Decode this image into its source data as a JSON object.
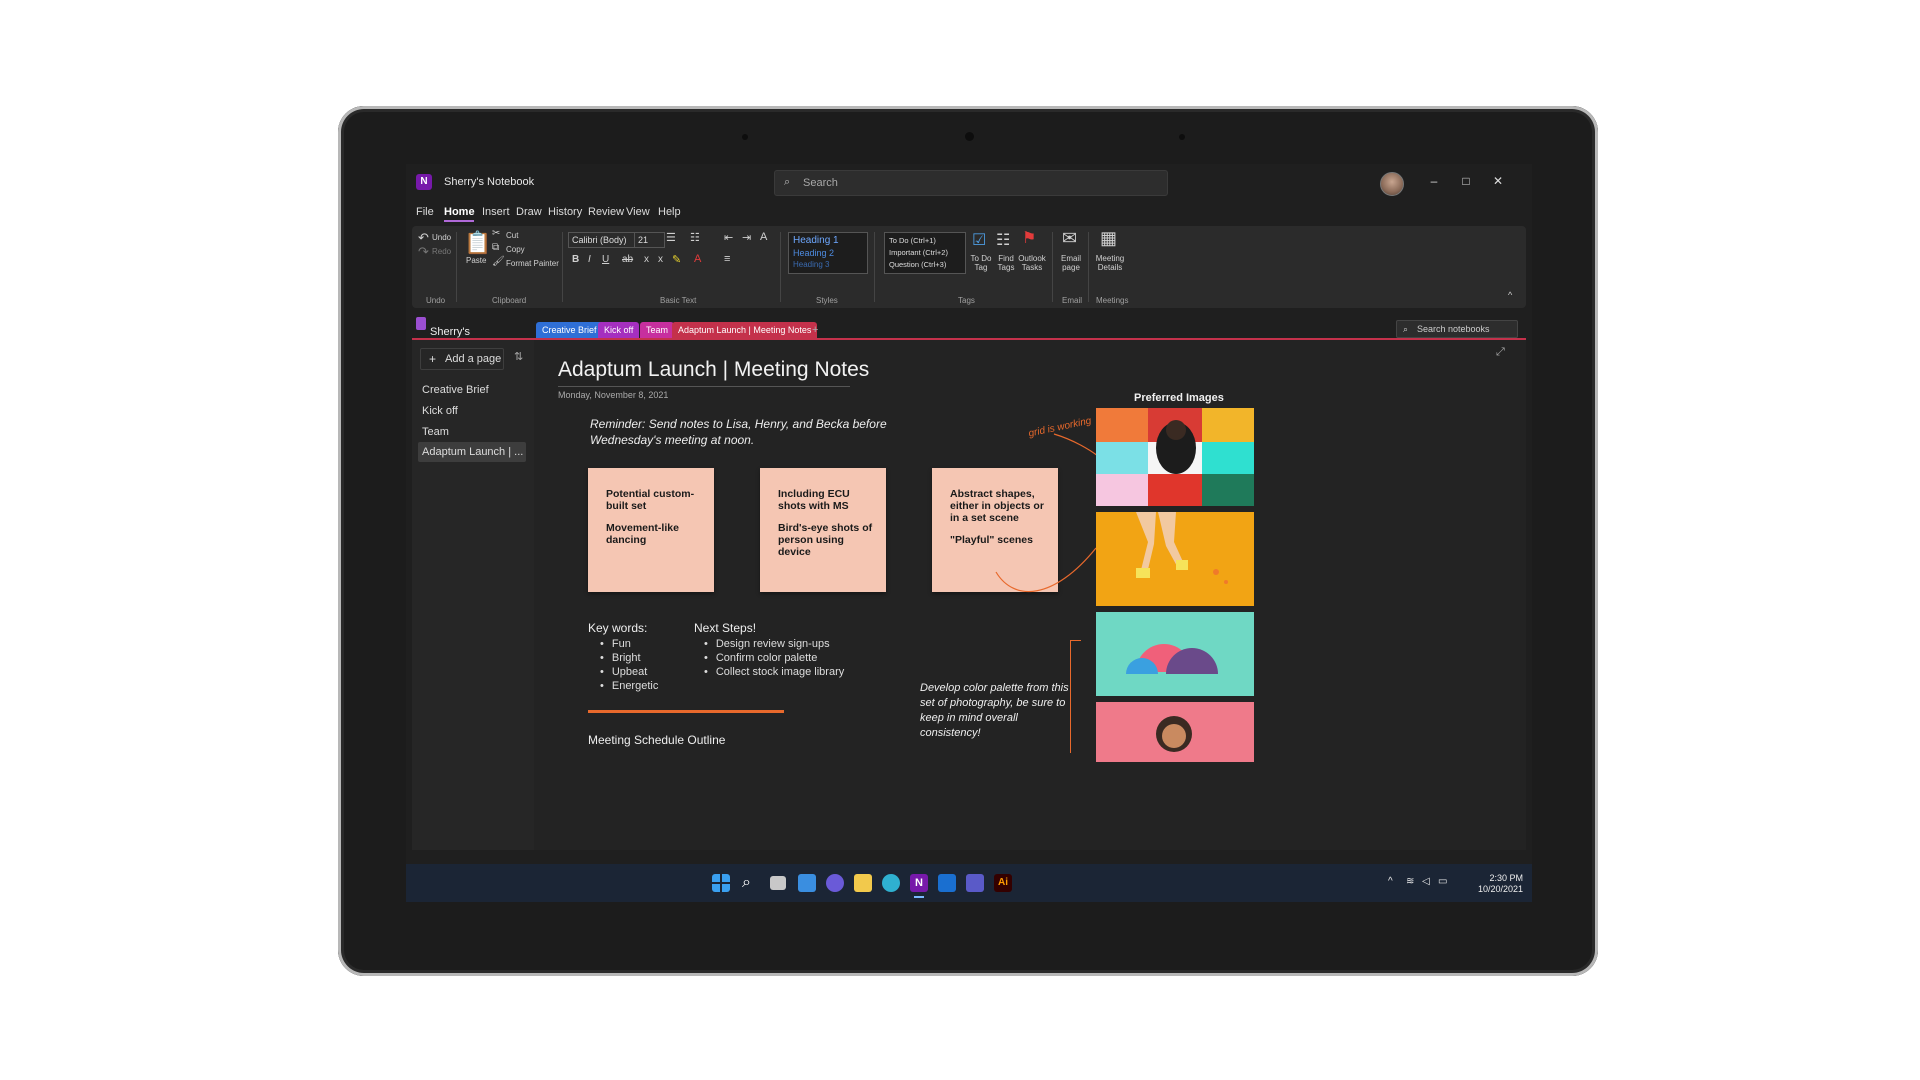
{
  "window": {
    "title": "Sherry's Notebook",
    "app_icon": "onenote-icon"
  },
  "search": {
    "placeholder": "Search"
  },
  "window_buttons": {
    "minimize": "–",
    "maximize": "□",
    "close": "✕"
  },
  "menu": [
    "File",
    "Home",
    "Insert",
    "Draw",
    "History",
    "Review",
    "View",
    "Help"
  ],
  "ribbon": {
    "undo": "Undo",
    "redo": "Redo",
    "undo_group": "Undo",
    "paste": "Paste",
    "cut": "Cut",
    "copy": "Copy",
    "format_painter": "Format Painter",
    "clipboard_group": "Clipboard",
    "font": "Calibri (Body)",
    "size": "21",
    "basic_text_group": "Basic Text",
    "styles": [
      "Heading 1",
      "Heading 2",
      "Heading 3"
    ],
    "styles_group": "Styles",
    "tags": [
      "To Do (Ctrl+1)",
      "Important (Ctrl+2)",
      "Question (Ctrl+3)"
    ],
    "todo_tag": "To Do Tag",
    "find_tags": "Find Tags",
    "outlook_tasks": "Outlook Tasks",
    "tags_group": "Tags",
    "email_page": "Email page",
    "email_group": "Email",
    "meeting_details": "Meeting Details",
    "meetings_group": "Meetings"
  },
  "notebook": {
    "name": "Sherry's Notebook",
    "search_label": "Search notebooks"
  },
  "sections": [
    {
      "label": "Creative Brief",
      "color": "#2f6fd6"
    },
    {
      "label": "Kick off",
      "color": "#a52fbf"
    },
    {
      "label": "Team",
      "color": "#c72f9e"
    },
    {
      "label": "Adaptum Launch | Meeting Notes",
      "color": "#c4314b"
    }
  ],
  "add_section": "+",
  "pages": {
    "add_label": "Add a page",
    "items": [
      "Creative Brief",
      "Kick off",
      "Team",
      "Adaptum Launch | ..."
    ]
  },
  "note": {
    "title": "Adaptum Launch | Meeting Notes",
    "date": "Monday, November 8, 2021",
    "reminder": "Reminder: Send notes to Lisa, Henry, and Becka before Wednesday's meeting at noon.",
    "stickies": [
      {
        "line1": "Potential custom-built set",
        "line2": "Movement-like dancing"
      },
      {
        "line1": "Including ECU shots with MS",
        "line2": "Bird's-eye shots of person using device"
      },
      {
        "line1": "Abstract shapes, either in objects or in a set scene",
        "line2": "\"Playful\" scenes"
      }
    ],
    "keywords_title": "Key words:",
    "keywords": [
      "Fun",
      "Bright",
      "Upbeat",
      "Energetic"
    ],
    "next_title": "Next Steps!",
    "next_steps": [
      "Design review sign-ups",
      "Confirm color palette",
      "Collect stock image library"
    ],
    "schedule": "Meeting Schedule Outline",
    "preferred_title": "Preferred Images",
    "handwritten": "grid is working",
    "develop": "Develop color palette from this set of photography, be sure to keep in mind overall consistency!"
  },
  "taskbar": {
    "icons": [
      "windows-icon",
      "search-icon",
      "task-view-icon",
      "widgets-icon",
      "chat-icon",
      "file-explorer-icon",
      "edge-icon",
      "onenote-icon",
      "outlook-icon",
      "teams-icon",
      "illustrator-icon"
    ],
    "time": "2:30 PM",
    "date": "10/20/2021"
  }
}
